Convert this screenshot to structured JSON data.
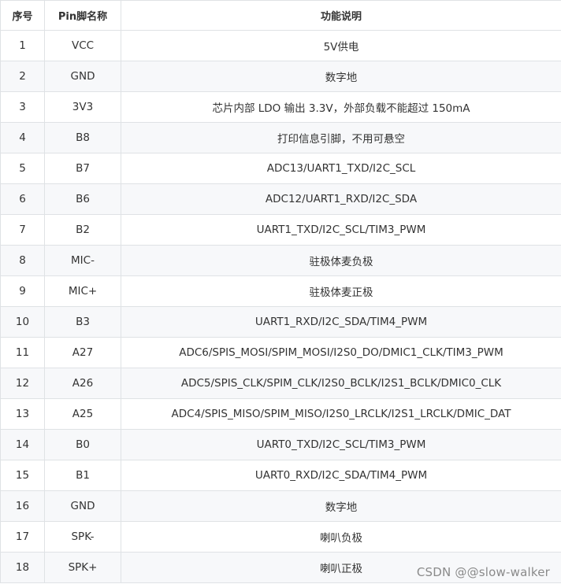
{
  "table": {
    "headers": [
      "序号",
      "Pin脚名称",
      "功能说明"
    ],
    "rows": [
      [
        "1",
        "VCC",
        "5V供电"
      ],
      [
        "2",
        "GND",
        "数字地"
      ],
      [
        "3",
        "3V3",
        "芯片内部 LDO 输出 3.3V，外部负载不能超过 150mA"
      ],
      [
        "4",
        "B8",
        "打印信息引脚，不用可悬空"
      ],
      [
        "5",
        "B7",
        "ADC13/UART1_TXD/I2C_SCL"
      ],
      [
        "6",
        "B6",
        "ADC12/UART1_RXD/I2C_SDA"
      ],
      [
        "7",
        "B2",
        "UART1_TXD/I2C_SCL/TIM3_PWM"
      ],
      [
        "8",
        "MIC-",
        "驻极体麦负极"
      ],
      [
        "9",
        "MIC+",
        "驻极体麦正极"
      ],
      [
        "10",
        "B3",
        "UART1_RXD/I2C_SDA/TIM4_PWM"
      ],
      [
        "11",
        "A27",
        "ADC6/SPIS_MOSI/SPIM_MOSI/I2S0_DO/DMIC1_CLK/TIM3_PWM"
      ],
      [
        "12",
        "A26",
        "ADC5/SPIS_CLK/SPIM_CLK/I2S0_BCLK/I2S1_BCLK/DMIC0_CLK"
      ],
      [
        "13",
        "A25",
        "ADC4/SPIS_MISO/SPIM_MISO/I2S0_LRCLK/I2S1_LRCLK/DMIC_DAT"
      ],
      [
        "14",
        "B0",
        "UART0_TXD/I2C_SCL/TIM3_PWM"
      ],
      [
        "15",
        "B1",
        "UART0_RXD/I2C_SDA/TIM4_PWM"
      ],
      [
        "16",
        "GND",
        "数字地"
      ],
      [
        "17",
        "SPK-",
        "喇叭负极"
      ],
      [
        "18",
        "SPK+",
        "喇叭正极"
      ]
    ]
  },
  "watermark": {
    "text": "CSDN @@slow-walker"
  }
}
